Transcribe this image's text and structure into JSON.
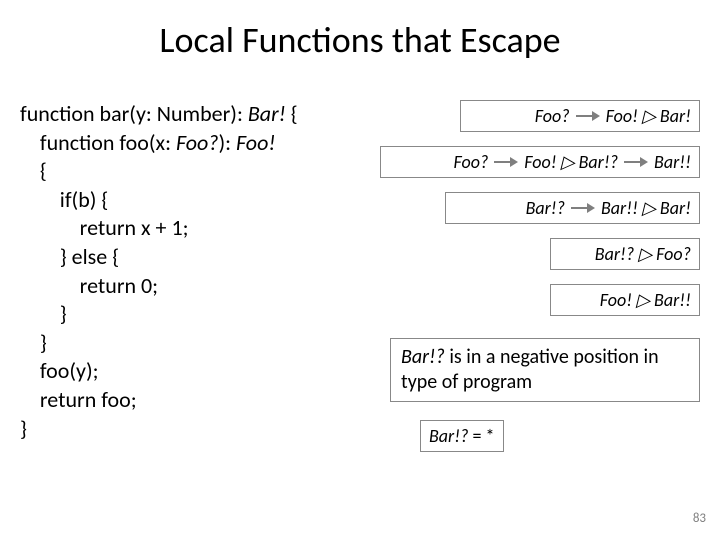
{
  "title": "Local Functions that Escape",
  "code": {
    "l1a": "function bar(y: Number): ",
    "l1b": "Bar!",
    "l1c": " {",
    "l2a": "    function foo(x: ",
    "l2b": "Foo?",
    "l2c": "): ",
    "l2d": "Foo!",
    "l3": "    {",
    "l4": "        if(b) {",
    "l5": "            return x + 1;",
    "l6": "        } else {",
    "l7": "            return 0;",
    "l8": "        }",
    "l9": "    }",
    "l10": "    foo(y);",
    "l11": "    return foo;",
    "l12": "}"
  },
  "rules": {
    "r1": {
      "a": "Foo?",
      "b": "Foo!  ▷  Bar!"
    },
    "r2": {
      "a": "Foo?",
      "b": "Foo!  ▷  Bar!?",
      "c": "Bar!!"
    },
    "r3": {
      "a": "Bar!?",
      "b": "Bar!!  ▷  Bar!"
    },
    "r4": {
      "a": "Bar!?  ▷ Foo?"
    },
    "r5": {
      "a": "Foo!  ▷  Bar!!"
    }
  },
  "note": {
    "t1": "Bar!?",
    "t2": " is in a negative position in type of program"
  },
  "eq": {
    "t1": "Bar!?",
    "t2": " = *"
  },
  "pagenum": "83"
}
